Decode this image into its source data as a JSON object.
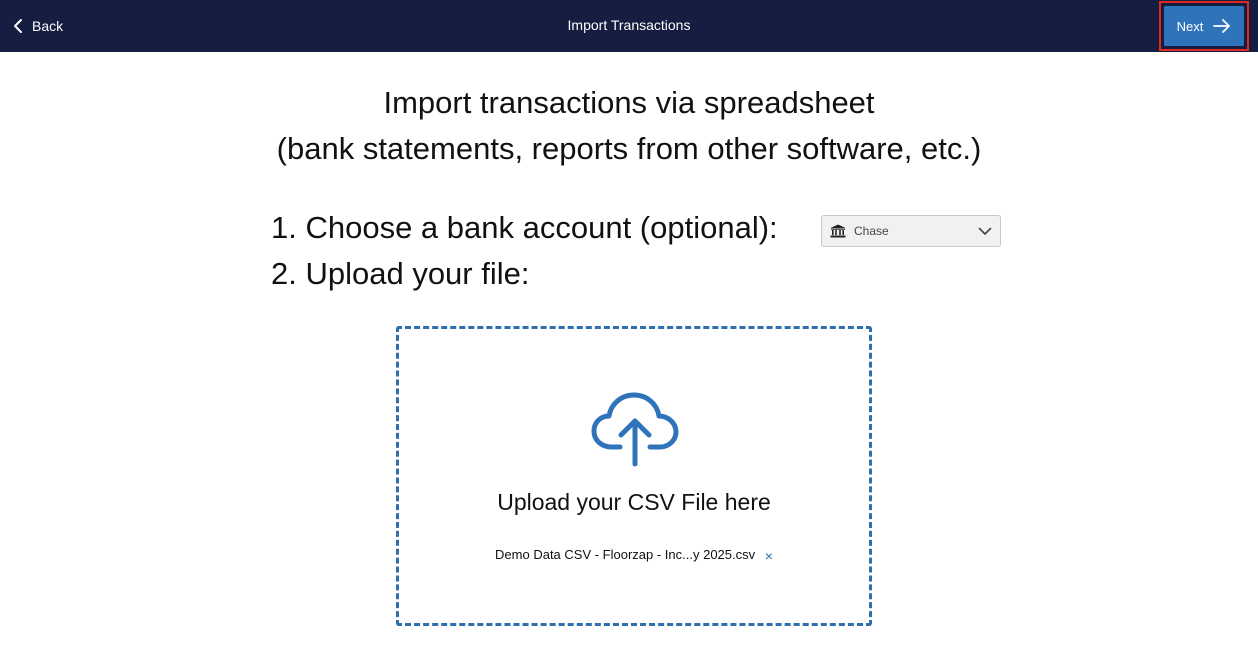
{
  "header": {
    "back_label": "Back",
    "title": "Import Transactions",
    "next_label": "Next"
  },
  "main": {
    "headline_line1": "Import transactions via spreadsheet",
    "headline_line2": "(bank statements, reports from other software, etc.)",
    "step1_label": "1. Choose a bank account (optional):",
    "step2_label": "2. Upload your file:",
    "bank_select": {
      "selected": "Chase",
      "icon": "bank-icon"
    },
    "upload": {
      "icon": "cloud-upload-icon",
      "prompt": "Upload your CSV File here",
      "file_name": "Demo Data CSV - Floorzap - Inc...y 2025.csv",
      "remove_symbol": "×"
    }
  },
  "colors": {
    "header_bg": "#151d40",
    "accent": "#2f74ba",
    "highlight_border": "#e02a20"
  }
}
